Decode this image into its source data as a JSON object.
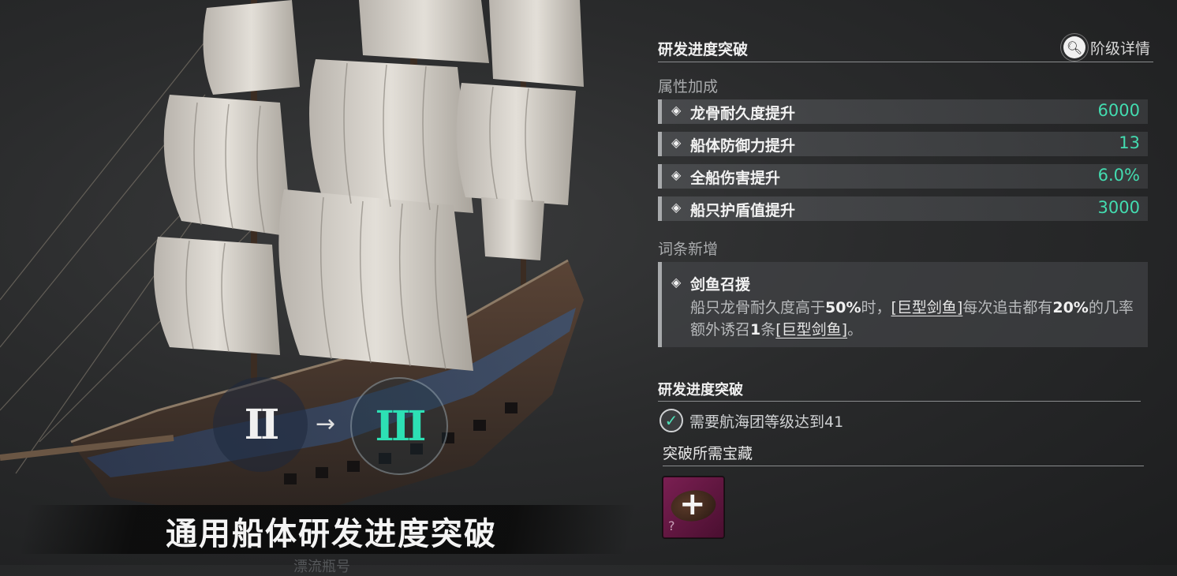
{
  "ship": {
    "tier_from": "II",
    "tier_arrow": "→",
    "tier_to": "III",
    "banner_title": "通用船体研发进度突破",
    "faded_subtitle": "漂流瓶号"
  },
  "panel": {
    "title": "研发进度突破",
    "tier_details_label": "阶级详情",
    "attributes_label": "属性加成",
    "stats": [
      {
        "name": "龙骨耐久度提升",
        "value": "6000"
      },
      {
        "name": "船体防御力提升",
        "value": "13"
      },
      {
        "name": "全船伤害提升",
        "value": "6.0%"
      },
      {
        "name": "船只护盾值提升",
        "value": "3000"
      }
    ],
    "perk_section_label": "词条新增",
    "perk": {
      "name": "剑鱼召援",
      "desc_1": "船只龙骨耐久度高于",
      "desc_2": "50%",
      "desc_3": "时，",
      "desc_link1": "[巨型剑鱼]",
      "desc_4": "每次追击都有",
      "desc_5": "20%",
      "desc_6": "的几率额外诱召",
      "desc_7": "1",
      "desc_8": "条",
      "desc_link2": "[巨型剑鱼]",
      "desc_9": "。"
    },
    "breakthrough_header": "研发进度突破",
    "requirement": "需要航海团等级达到41",
    "treasure_header": "突破所需宝藏",
    "treasure_plus": "+",
    "treasure_question": "?"
  },
  "colors": {
    "accent_teal": "#43dcb0",
    "treasure_magenta": "#7a1f52"
  },
  "icons": [
    "magnifier-icon",
    "diamond-bullet-icon",
    "check-icon",
    "plus-icon",
    "arrow-right-icon"
  ]
}
